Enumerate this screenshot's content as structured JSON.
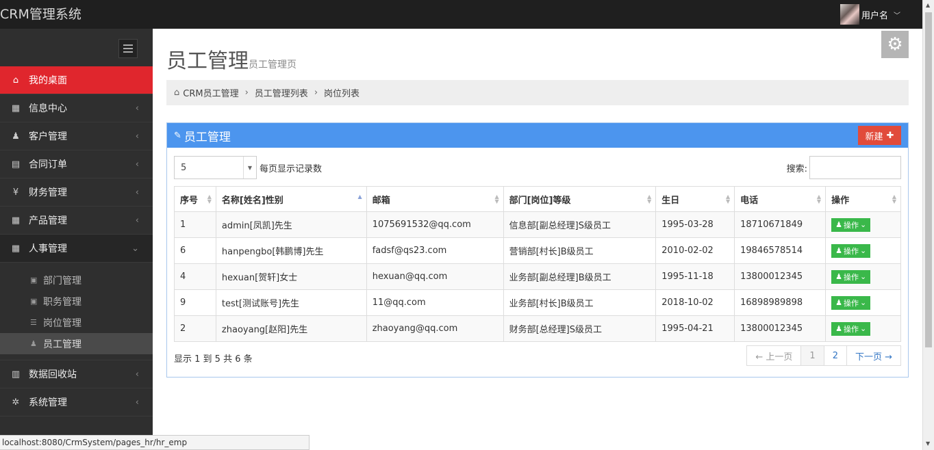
{
  "app": {
    "title": "CRM管理系统",
    "username": "用户名"
  },
  "sidebar": {
    "items": [
      {
        "label": "我的桌面",
        "icon": "home-icon"
      },
      {
        "label": "信息中心",
        "icon": "calendar-icon"
      },
      {
        "label": "客户管理",
        "icon": "person-icon"
      },
      {
        "label": "合同订单",
        "icon": "book-icon"
      },
      {
        "label": "财务管理",
        "icon": "yen-icon"
      },
      {
        "label": "产品管理",
        "icon": "grid-icon"
      },
      {
        "label": "人事管理",
        "icon": "table-icon"
      }
    ],
    "subitems": [
      {
        "label": "部门管理"
      },
      {
        "label": "职务管理"
      },
      {
        "label": "岗位管理"
      },
      {
        "label": "员工管理"
      }
    ],
    "items_after": [
      {
        "label": "数据回收站",
        "icon": "trash-icon"
      },
      {
        "label": "系统管理",
        "icon": "cog-icon"
      }
    ]
  },
  "page": {
    "title": "员工管理",
    "subtitle": "员工管理页"
  },
  "breadcrumb": {
    "home": "CRM员工管理",
    "level2": "员工管理列表",
    "level3": "岗位列表"
  },
  "box": {
    "title": "员工管理",
    "new_label": "新建"
  },
  "table_controls": {
    "page_length": "5",
    "length_label": "每页显示记录数",
    "search_label": "搜索:"
  },
  "table": {
    "headers": [
      "序号",
      "名称[姓名]性别",
      "邮箱",
      "部门[岗位]等级",
      "生日",
      "电话",
      "操作"
    ],
    "action_label": "操作",
    "rows": [
      {
        "id": "1",
        "name": "admin[凤凯]先生",
        "email": "1075691532@qq.com",
        "dept": "信息部[副总经理]S级员工",
        "birthday": "1995-03-28",
        "phone": "18710671849"
      },
      {
        "id": "6",
        "name": "hanpengbo[韩鹏博]先生",
        "email": "fadsf@qs23.com",
        "dept": "营销部[村长]B级员工",
        "birthday": "2010-02-02",
        "phone": "19846578514"
      },
      {
        "id": "4",
        "name": "hexuan[贺轩]女士",
        "email": "hexuan@qq.com",
        "dept": "业务部[副总经理]B级员工",
        "birthday": "1995-11-18",
        "phone": "13800012345"
      },
      {
        "id": "9",
        "name": "test[测试账号]先生",
        "email": "11@qq.com",
        "dept": "业务部[村长]B级员工",
        "birthday": "2018-10-02",
        "phone": "16898989898"
      },
      {
        "id": "2",
        "name": "zhaoyang[赵阳]先生",
        "email": "zhaoyang@qq.com",
        "dept": "财务部[总经理]S级员工",
        "birthday": "1995-04-21",
        "phone": "13800012345"
      }
    ]
  },
  "pagination": {
    "info": "显示 1 到 5 共 6 条",
    "prev": "← 上一页",
    "page1": "1",
    "page2": "2",
    "next": "下一页 →"
  },
  "statusbar": {
    "url": "localhost:8080/CrmSystem/pages_hr/hr_emp"
  },
  "colors": {
    "active_menu": "#e0262d",
    "box_header": "#4c95ee",
    "new_button": "#e14b3b",
    "action_button": "#3ab84a"
  }
}
